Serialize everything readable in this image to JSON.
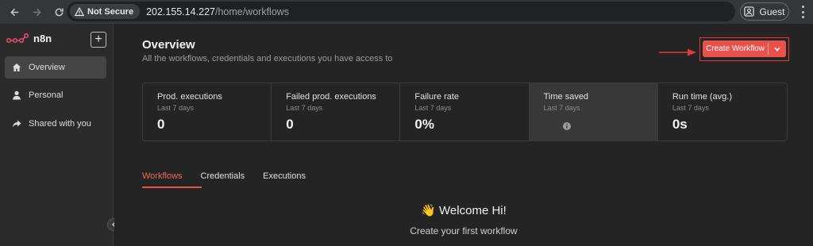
{
  "browser": {
    "security_label": "Not Secure",
    "url_host": "202.155.14.227",
    "url_path": "/home/workflows",
    "profile_label": "Guest"
  },
  "sidebar": {
    "brand": "n8n",
    "add_button_label": "+",
    "items": [
      {
        "label": "Overview",
        "icon": "home-icon",
        "active": true
      },
      {
        "label": "Personal",
        "icon": "user-icon",
        "active": false
      },
      {
        "label": "Shared with you",
        "icon": "share-icon",
        "active": false
      }
    ]
  },
  "header": {
    "title": "Overview",
    "subtitle": "All the workflows, credentials and executions you have access to",
    "create_button_label": "Create Workflow"
  },
  "stats": [
    {
      "label": "Prod. executions",
      "period": "Last 7 days",
      "value": "0"
    },
    {
      "label": "Failed prod. executions",
      "period": "Last 7 days",
      "value": "0"
    },
    {
      "label": "Failure rate",
      "period": "Last 7 days",
      "value": "0%"
    },
    {
      "label": "Time saved",
      "period": "Last 7 days",
      "value": ""
    },
    {
      "label": "Run time (avg.)",
      "period": "Last 7 days",
      "value": "0s"
    }
  ],
  "tabs": [
    {
      "label": "Workflows",
      "active": true
    },
    {
      "label": "Credentials",
      "active": false
    },
    {
      "label": "Executions",
      "active": false
    }
  ],
  "empty_state": {
    "emoji": "👋",
    "title": "Welcome Hi!",
    "subtitle": "Create your first workflow"
  },
  "colors": {
    "accent": "#e8524a",
    "background": "#242424",
    "sidebar": "#2b2b2b",
    "annotation": "#e03a3a"
  }
}
